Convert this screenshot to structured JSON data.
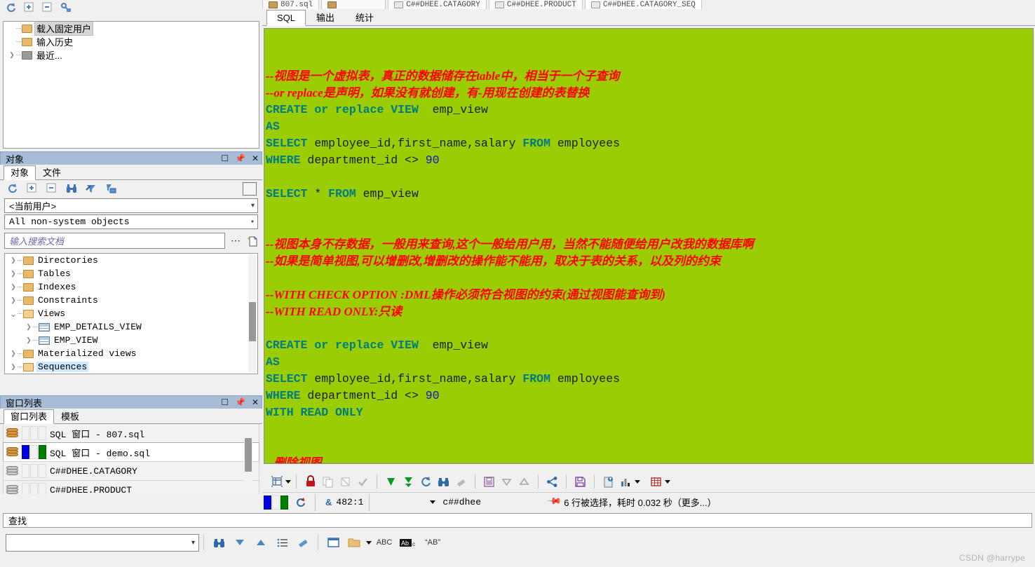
{
  "top_tabs": [
    {
      "label": "807.sql",
      "icon": "db-icon",
      "active": false
    },
    {
      "label": "",
      "icon": "db-icon",
      "active": false
    },
    {
      "label": "C##DHEE.CATAGORY",
      "icon": "grid-icon",
      "active": false
    },
    {
      "label": "C##DHEE.PRODUCT",
      "icon": "grid-icon",
      "active": false
    },
    {
      "label": "C##DHEE.CATAGORY_SEQ",
      "icon": "grid-icon",
      "active": true
    }
  ],
  "left": {
    "session_toolbar": [
      "refresh-icon",
      "expand-icon",
      "collapse-icon",
      "key-icon"
    ],
    "session_tree": [
      {
        "label": "载入固定用户",
        "icon": "folder-icon",
        "selected": true,
        "expandable": false
      },
      {
        "label": "输入历史",
        "icon": "folder-icon",
        "selected": false,
        "expandable": false
      },
      {
        "label": "最近...",
        "icon": "folder-grey-icon",
        "selected": false,
        "expandable": true
      }
    ],
    "objects_panel": {
      "title": "对象",
      "window_buttons": [
        "maximize-icon",
        "pin-icon",
        "close-icon"
      ],
      "tabs": [
        {
          "label": "对象",
          "active": true
        },
        {
          "label": "文件",
          "active": false
        }
      ],
      "toolbar": [
        "refresh-icon",
        "expand-icon",
        "collapse-icon",
        "binoculars-icon",
        "filter-remove-icon",
        "filter-icon"
      ],
      "user_select": "<当前用户>",
      "filter_select": "All non-system objects",
      "search_placeholder": "输入搜索文档",
      "search_value": "",
      "search_buttons": [
        "ellipsis-icon",
        "new-doc-icon"
      ],
      "tree": [
        {
          "label": "Directories",
          "icon": "folder-icon",
          "indent": 0,
          "expandable": true,
          "expanded": false,
          "selected": false
        },
        {
          "label": "Tables",
          "icon": "folder-icon",
          "indent": 0,
          "expandable": true,
          "expanded": false,
          "selected": false
        },
        {
          "label": "Indexes",
          "icon": "folder-icon",
          "indent": 0,
          "expandable": true,
          "expanded": false,
          "selected": false
        },
        {
          "label": "Constraints",
          "icon": "folder-icon",
          "indent": 0,
          "expandable": true,
          "expanded": false,
          "selected": false
        },
        {
          "label": "Views",
          "icon": "folder-open-icon",
          "indent": 0,
          "expandable": true,
          "expanded": true,
          "selected": false
        },
        {
          "label": "EMP_DETAILS_VIEW",
          "icon": "view-icon",
          "indent": 1,
          "expandable": true,
          "expanded": false,
          "selected": false
        },
        {
          "label": "EMP_VIEW",
          "icon": "view-icon",
          "indent": 1,
          "expandable": true,
          "expanded": false,
          "selected": false
        },
        {
          "label": "Materialized views",
          "icon": "folder-icon",
          "indent": 0,
          "expandable": true,
          "expanded": false,
          "selected": false
        },
        {
          "label": "Sequences",
          "icon": "folder-open-icon",
          "indent": 0,
          "expandable": true,
          "expanded": false,
          "selected": true
        }
      ]
    },
    "windows_panel": {
      "title": "窗口列表",
      "window_buttons": [
        "maximize-icon",
        "pin-icon",
        "close-icon"
      ],
      "tabs": [
        {
          "label": "窗口列表",
          "active": true
        },
        {
          "label": "模板",
          "active": false
        }
      ],
      "rows": [
        {
          "label": "SQL 窗口 - 807.sql",
          "icon": "db-icon",
          "selected": false,
          "flags": [
            "",
            "",
            ""
          ]
        },
        {
          "label": "SQL 窗口 - demo.sql",
          "icon": "db-icon",
          "selected": true,
          "flags": [
            "blue",
            "",
            "green"
          ]
        },
        {
          "label": "C##DHEE.CATAGORY",
          "icon": "db-grey-icon",
          "selected": false,
          "flags": [
            "",
            "",
            ""
          ]
        },
        {
          "label": "C##DHEE.PRODUCT",
          "icon": "db-grey-icon",
          "selected": false,
          "flags": [
            "",
            "",
            ""
          ]
        }
      ]
    }
  },
  "sql_panel": {
    "tabs": [
      {
        "label": "SQL",
        "active": true
      },
      {
        "label": "输出",
        "active": false
      },
      {
        "label": "统计",
        "active": false
      }
    ],
    "editor_background": "#9ACD03",
    "comment_color": "#FF0000",
    "keyword_color": "#007C84",
    "lines": [
      {
        "t": "blank"
      },
      {
        "t": "blank"
      },
      {
        "t": "comment",
        "text": "--视图是一个虚拟表，真正的数据储存在table中，相当于一个子查询"
      },
      {
        "t": "comment",
        "text": "--or replace是声明，如果没有就创建，有-用现在创建的表替换"
      },
      {
        "t": "code",
        "tokens": [
          [
            "kw",
            "CREATE"
          ],
          [
            "id",
            " "
          ],
          [
            "kw",
            "or replace"
          ],
          [
            "id",
            " "
          ],
          [
            "kw",
            "VIEW"
          ],
          [
            "id",
            "  emp_view"
          ]
        ]
      },
      {
        "t": "code",
        "tokens": [
          [
            "kw",
            "AS"
          ]
        ]
      },
      {
        "t": "code",
        "tokens": [
          [
            "kw",
            "SELECT"
          ],
          [
            "id",
            " employee_id,first_name,salary "
          ],
          [
            "kw",
            "FROM"
          ],
          [
            "id",
            " employees"
          ]
        ]
      },
      {
        "t": "code",
        "tokens": [
          [
            "kw",
            "WHERE"
          ],
          [
            "id",
            " department_id "
          ],
          [
            "op",
            "<> "
          ],
          [
            "num",
            "90"
          ]
        ]
      },
      {
        "t": "blank"
      },
      {
        "t": "code",
        "tokens": [
          [
            "kw",
            "SELECT"
          ],
          [
            "id",
            " "
          ],
          [
            "op",
            "*"
          ],
          [
            "id",
            " "
          ],
          [
            "kw",
            "FROM"
          ],
          [
            "id",
            " emp_view"
          ]
        ]
      },
      {
        "t": "blank"
      },
      {
        "t": "blank"
      },
      {
        "t": "comment",
        "text": "--视图本身不存数据，一般用来查询,这个一般给用户用，当然不能随便给用户改我的数据库啊"
      },
      {
        "t": "comment",
        "text": "--如果是简单视图,可以增删改,增删改的操作能不能用，取决于表的关系，以及列的约束"
      },
      {
        "t": "blank"
      },
      {
        "t": "comment",
        "text": "--WITH CHECK OPTION :DML操作必须符合视图的约束(通过视图能查询到)"
      },
      {
        "t": "comment",
        "text": "--WITH READ ONLY:只读"
      },
      {
        "t": "blank"
      },
      {
        "t": "code",
        "tokens": [
          [
            "kw",
            "CREATE"
          ],
          [
            "id",
            " "
          ],
          [
            "kw",
            "or replace"
          ],
          [
            "id",
            " "
          ],
          [
            "kw",
            "VIEW"
          ],
          [
            "id",
            "  emp_view"
          ]
        ]
      },
      {
        "t": "code",
        "tokens": [
          [
            "kw",
            "AS"
          ]
        ]
      },
      {
        "t": "code",
        "tokens": [
          [
            "kw",
            "SELECT"
          ],
          [
            "id",
            " employee_id,first_name,salary "
          ],
          [
            "kw",
            "FROM"
          ],
          [
            "id",
            " employees"
          ]
        ]
      },
      {
        "t": "code",
        "tokens": [
          [
            "kw",
            "WHERE"
          ],
          [
            "id",
            " department_id "
          ],
          [
            "op",
            "<> "
          ],
          [
            "num",
            "90"
          ]
        ]
      },
      {
        "t": "code",
        "tokens": [
          [
            "kw",
            "WITH READ ONLY"
          ]
        ]
      },
      {
        "t": "blank"
      },
      {
        "t": "blank"
      },
      {
        "t": "comment",
        "text": "--删除视图"
      }
    ],
    "toolbar_icons": [
      "insert-record-icon",
      "dropdown-arrow",
      "lock-icon",
      "copy-icon",
      "paste-icon",
      "check-icon",
      "export-down-icon",
      "export-all-down-icon",
      "refresh-icon",
      "find-icon",
      "eraser-icon",
      "save-grid-icon",
      "sort-desc-icon",
      "sort-asc-icon",
      "link-icon",
      "save-icon",
      "upload-doc-icon",
      "chart-icon",
      "chart-dropdown",
      "grid-icon",
      "grid-dropdown"
    ],
    "status": {
      "flags": [
        "blue",
        "",
        "green"
      ],
      "exec_icon": "execute-icon",
      "amp_icon": "variable-icon",
      "cursor_position": "482:1",
      "connection": "c##dhee",
      "result_text": "6 行被选择，耗时 0.032 秒（更多...）",
      "pin_icon": "pin-icon"
    }
  },
  "find_panel": {
    "title": "查找",
    "input_value": "",
    "buttons": [
      "binoculars-icon",
      "find-down-icon",
      "find-up-icon",
      "list-icon",
      "eraser-icon",
      "window-icon",
      "folder-icon",
      "folder-dropdown",
      "abc-icon",
      "match-case-icon",
      "whole-word-icon"
    ]
  },
  "watermark": "CSDN @harrype"
}
